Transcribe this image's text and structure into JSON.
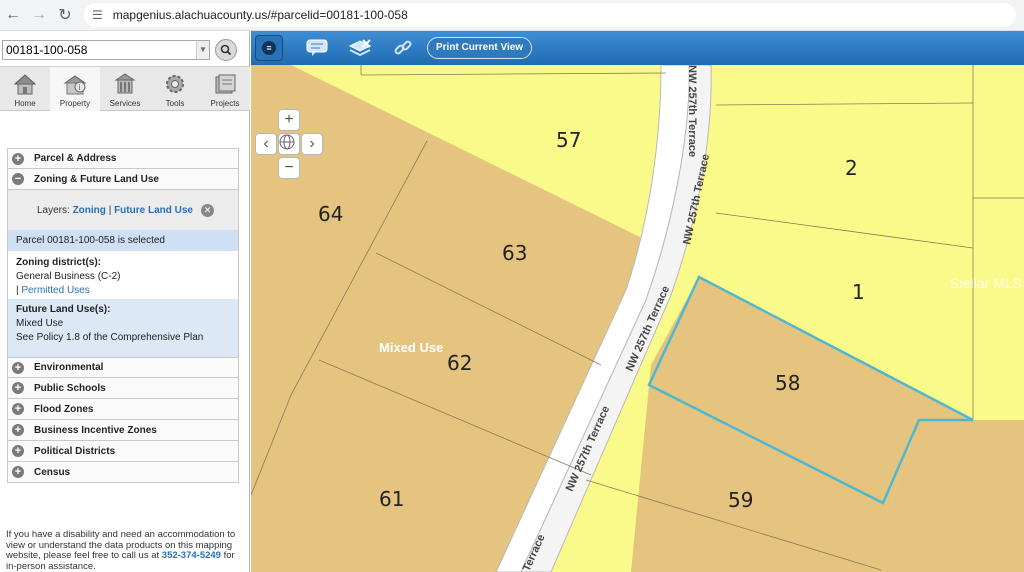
{
  "browser": {
    "url": "mapgenius.alachuacounty.us/#parcelid=00181-100-058"
  },
  "search": {
    "value": "00181-100-058"
  },
  "tabs": [
    {
      "label": "Home"
    },
    {
      "label": "Property"
    },
    {
      "label": "Services"
    },
    {
      "label": "Tools"
    },
    {
      "label": "Projects"
    }
  ],
  "panel": {
    "parcel_address": "Parcel & Address",
    "zoning_flu": "Zoning & Future Land Use",
    "layers_label": "Layers:",
    "layer_zoning": "Zoning",
    "layer_sep": "|",
    "layer_flu": "Future Land Use",
    "selected": "Parcel 00181-100-058 is selected",
    "zoning_heading": "Zoning district(s):",
    "zoning_value": "General Business (C-2)",
    "permitted_sep": "|",
    "permitted_link": "Permitted Uses",
    "flu_heading": "Future Land Use(s):",
    "flu_value": "Mixed Use",
    "flu_policy": "See Policy 1.8 of the Comprehensive Plan",
    "sections": [
      "Environmental",
      "Public Schools",
      "Flood Zones",
      "Business Incentive Zones",
      "Political Districts",
      "Census"
    ],
    "access_text": "If you have a disability and need an accommodation to view or understand the data products on this mapping website, please feel free to call us at",
    "phone": "352-374-5249",
    "access_tail": "for in-person assistance."
  },
  "toolbar": {
    "print_label": "Print Current View"
  },
  "map": {
    "parcels": [
      "57",
      "2",
      "64",
      "63",
      "1",
      "62",
      "58",
      "61",
      "59"
    ],
    "road_labels": [
      "NW 257th Terrace",
      "NW 257th Terrace",
      "NW 257th Terrace",
      "NW 257th Terrace",
      "Terrace"
    ],
    "zone_label": "Mixed Use",
    "watermark": "Stellar MLS",
    "colors": {
      "tan": "#e5c47f",
      "yellow": "#fafa8a",
      "highlight": "#4fb8d0"
    }
  }
}
